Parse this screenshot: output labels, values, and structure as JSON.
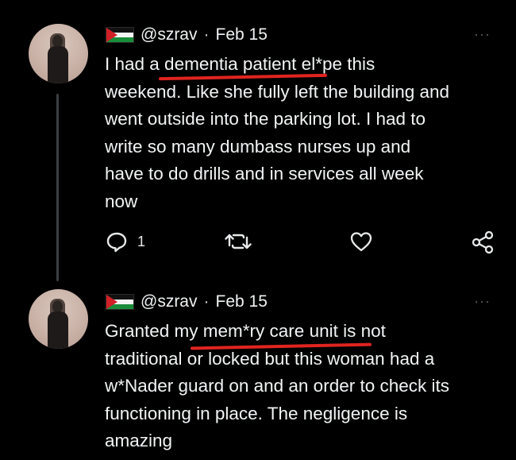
{
  "tweets": [
    {
      "handle": "@szrav",
      "separator": "·",
      "date": "Feb 15",
      "more": "···",
      "lines": [
        "I had a dementia patient el*pe this",
        "weekend. Like she fully left the building and",
        "went outside into the parking lot. I had to",
        "write so many dumbass nurses up and",
        "have to do drills and in services all week",
        "now"
      ],
      "reply_count": "1"
    },
    {
      "handle": "@szrav",
      "separator": "·",
      "date": "Feb 15",
      "more": "···",
      "lines": [
        "Granted my mem*ry care unit is not",
        "traditional or locked but this woman had a",
        "w*Nader guard on and an order to check its",
        "functioning in place. The negligence is",
        "amazing"
      ]
    }
  ],
  "icons": {
    "flag": "palestine-flag-icon",
    "reply": "reply-icon",
    "retweet": "retweet-icon",
    "like": "heart-icon",
    "share": "share-icon",
    "more": "more-options-icon"
  },
  "colors": {
    "background": "#000000",
    "text": "#e7e9ea",
    "underline_annotation": "#e0241f",
    "thread_line": "#3a3e43"
  }
}
